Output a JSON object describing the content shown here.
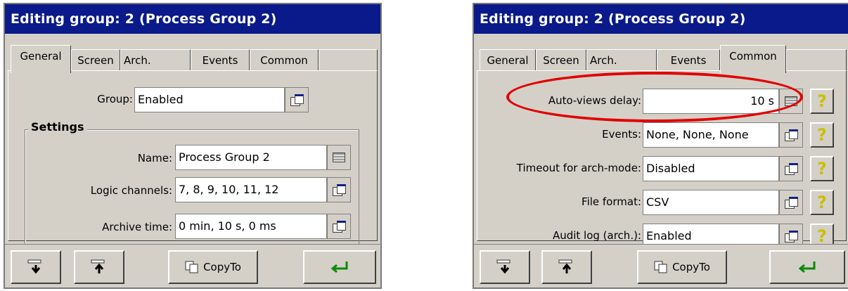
{
  "left_dialog": {
    "title": "Editing group: 2 (Process Group 2)",
    "tabs": [
      "General",
      "Screen",
      "Arch.",
      "Events",
      "Common"
    ],
    "active_tab": "General",
    "group": {
      "label": "Group:",
      "value": "Enabled"
    },
    "settings": {
      "title": "Settings",
      "name": {
        "label": "Name:",
        "value": "Process Group 2"
      },
      "logic_channels": {
        "label": "Logic channels:",
        "value": "7, 8, 9, 10, 11, 12"
      },
      "archive_time": {
        "label": "Archive time:",
        "value": "0 min, 10 s, 0 ms"
      }
    },
    "toolbar": {
      "copy_label": "CopyTo",
      "icons": [
        "move-down-icon",
        "move-up-icon",
        "copy-icon",
        "enter-icon"
      ]
    }
  },
  "right_dialog": {
    "title": "Editing group: 2 (Process Group 2)",
    "tabs": [
      "General",
      "Screen",
      "Arch.",
      "Events",
      "Common"
    ],
    "active_tab": "Common",
    "rows": [
      {
        "label": "Auto-views delay:",
        "value": "10 s",
        "icon": "table-icon"
      },
      {
        "label": "Events:",
        "value": "None, None, None",
        "icon": "window-icon"
      },
      {
        "label": "Timeout for arch-mode:",
        "value": "Disabled",
        "icon": "window-icon"
      },
      {
        "label": "File format:",
        "value": "CSV",
        "icon": "window-icon"
      },
      {
        "label": "Audit log (arch.):",
        "value": "Enabled",
        "icon": "window-icon"
      }
    ],
    "toolbar": {
      "copy_label": "CopyTo"
    }
  },
  "colors": {
    "titlebar": "#0a1a8a",
    "highlight_ellipse": "#e00000",
    "help_icon": "#c8c000"
  }
}
